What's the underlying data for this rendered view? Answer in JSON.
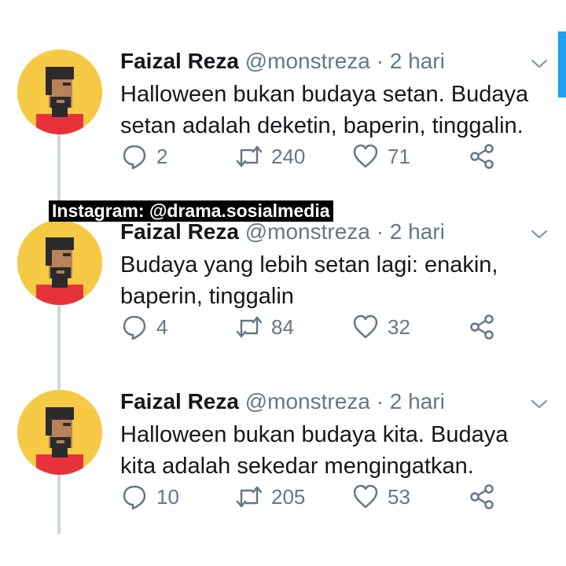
{
  "watermark": "Instagram: @drama.sosialmedia",
  "icons": {
    "reply": "reply-bubble-icon",
    "retweet": "retweet-icon",
    "like": "heart-icon",
    "share": "share-icon",
    "caret": "chevron-down-icon"
  },
  "colors": {
    "muted": "#657786",
    "thread_line": "#ccd6dd",
    "accent": "#1da1f2",
    "avatar_bg": "#f6c944"
  },
  "tweets": [
    {
      "name": "Faizal Reza",
      "handle": "@monstreza",
      "separator": "·",
      "time": "2 hari",
      "text": "Halloween bukan budaya setan. Budaya setan adalah deketin, baperin, tinggalin.",
      "replies": "2",
      "retweets": "240",
      "likes": "71"
    },
    {
      "name": "Faizal Reza",
      "handle": "@monstreza",
      "separator": "·",
      "time": "2 hari",
      "text": "Budaya yang lebih setan lagi: enakin, baperin, tinggalin",
      "replies": "4",
      "retweets": "84",
      "likes": "32"
    },
    {
      "name": "Faizal Reza",
      "handle": "@monstreza",
      "separator": "·",
      "time": "2 hari",
      "text": "Halloween bukan budaya kita. Budaya kita adalah sekedar mengingatkan.",
      "replies": "10",
      "retweets": "205",
      "likes": "53"
    }
  ]
}
